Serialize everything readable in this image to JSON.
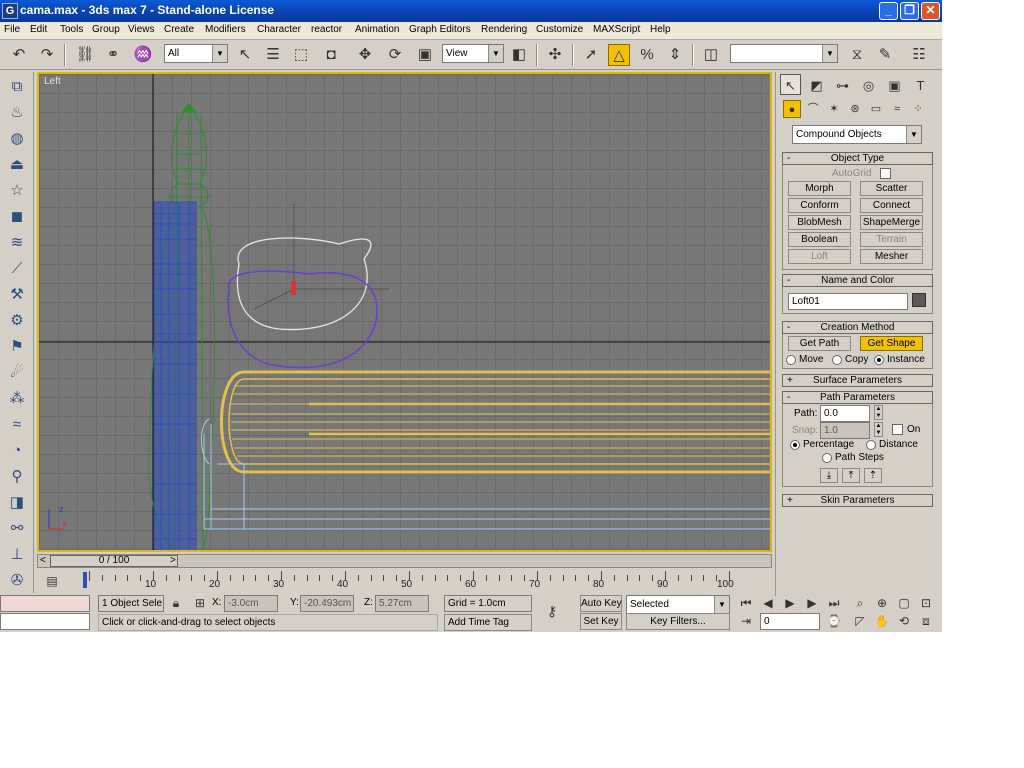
{
  "window": {
    "title": "cama.max - 3ds max 7 - Stand-alone License",
    "min_glyph": "_",
    "max_glyph": "❐",
    "close_glyph": "✕"
  },
  "menu": [
    "File",
    "Edit",
    "Tools",
    "Group",
    "Views",
    "Create",
    "Modifiers",
    "Character",
    "reactor",
    "Animation",
    "Graph Editors",
    "Rendering",
    "Customize",
    "MAXScript",
    "Help"
  ],
  "toolbar": {
    "selection_filter": "All",
    "reference_coord": "View",
    "named_selection": ""
  },
  "viewport": {
    "label": "Left",
    "axis_z": "z",
    "axis_x": "x"
  },
  "timeslider": {
    "frame": "0 / 100",
    "prev": "<",
    "next": ">"
  },
  "trackbar": {
    "labels": [
      "10",
      "20",
      "30",
      "40",
      "50",
      "60",
      "70",
      "80",
      "90",
      "100"
    ]
  },
  "status": {
    "selection": "1 Object Sele",
    "x_label": "X:",
    "x_value": "-3.0cm",
    "y_label": "Y:",
    "y_value": "-20.493cm",
    "z_label": "Z:",
    "z_value": "5.27cm",
    "grid": "Grid = 1.0cm",
    "prompt": "Click or click-and-drag to select objects",
    "add_time_tag": "Add Time Tag",
    "auto_key": "Auto Key",
    "set_key": "Set Key",
    "selected": "Selected",
    "key_filters": "Key Filters...",
    "frame": "0"
  },
  "command_panel": {
    "category": "Compound Objects",
    "object_type": {
      "header": "Object Type",
      "autogrid": "AutoGrid",
      "buttons": [
        "Morph",
        "Scatter",
        "Conform",
        "Connect",
        "BlobMesh",
        "ShapeMerge",
        "Boolean",
        "Terrain",
        "Loft",
        "Mesher"
      ]
    },
    "name_color": {
      "header": "Name and Color",
      "name": "Loft01",
      "color": "#5a5a5a"
    },
    "creation_method": {
      "header": "Creation Method",
      "get_path": "Get Path",
      "get_shape": "Get Shape",
      "move": "Move",
      "copy": "Copy",
      "instance": "Instance"
    },
    "surface_parameters": {
      "header": "Surface Parameters"
    },
    "path_parameters": {
      "header": "Path Parameters",
      "path_label": "Path:",
      "path_value": "0.0",
      "snap_label": "Snap:",
      "snap_value": "1.0",
      "on": "On",
      "percentage": "Percentage",
      "distance": "Distance",
      "path_steps": "Path Steps"
    },
    "skin_parameters": {
      "header": "Skin Parameters"
    }
  },
  "colors": {
    "accent": "#f2c200",
    "viewport_bg": "#777777",
    "loft_yellow": "#e3c04a",
    "pillar_green": "#2f8f2f",
    "pillar_blue": "#2b4fb8",
    "shape_purple": "#6a3fd0"
  }
}
